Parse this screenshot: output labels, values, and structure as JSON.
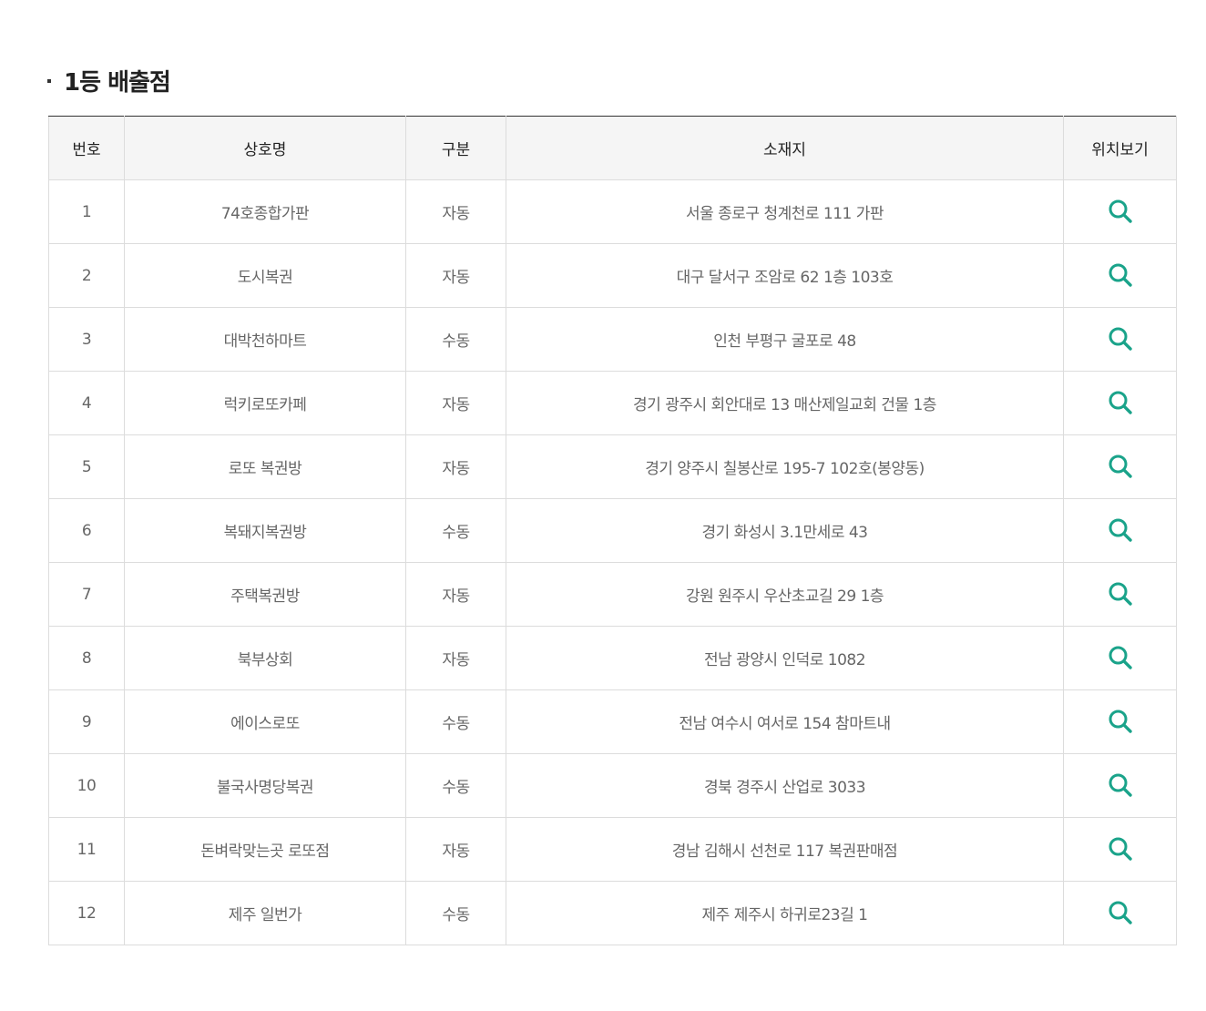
{
  "section": {
    "title": "1등 배출점"
  },
  "table": {
    "columns": [
      "번호",
      "상호명",
      "구분",
      "소재지",
      "위치보기"
    ],
    "rows": [
      {
        "no": "1",
        "name": "74호종합가판",
        "type": "자동",
        "address": "서울 종로구 청계천로 111 가판"
      },
      {
        "no": "2",
        "name": "도시복권",
        "type": "자동",
        "address": "대구 달서구 조암로 62 1층 103호"
      },
      {
        "no": "3",
        "name": "대박천하마트",
        "type": "수동",
        "address": "인천 부평구 굴포로 48"
      },
      {
        "no": "4",
        "name": "럭키로또카페",
        "type": "자동",
        "address": "경기 광주시 회안대로 13 매산제일교회 건물 1층"
      },
      {
        "no": "5",
        "name": "로또 복권방",
        "type": "자동",
        "address": "경기 양주시 칠봉산로 195-7 102호(봉양동)"
      },
      {
        "no": "6",
        "name": "복돼지복권방",
        "type": "수동",
        "address": "경기 화성시 3.1만세로 43"
      },
      {
        "no": "7",
        "name": "주택복권방",
        "type": "자동",
        "address": "강원 원주시 우산초교길 29 1층"
      },
      {
        "no": "8",
        "name": "북부상회",
        "type": "자동",
        "address": "전남 광양시 인덕로 1082"
      },
      {
        "no": "9",
        "name": "에이스로또",
        "type": "수동",
        "address": "전남 여수시 여서로 154 참마트내"
      },
      {
        "no": "10",
        "name": "불국사명당복권",
        "type": "수동",
        "address": "경북 경주시 산업로 3033"
      },
      {
        "no": "11",
        "name": "돈벼락맞는곳 로또점",
        "type": "자동",
        "address": "경남 김해시 선천로 117 복권판매점"
      },
      {
        "no": "12",
        "name": "제주 일번가",
        "type": "수동",
        "address": "제주 제주시 하귀로23길 1"
      }
    ]
  },
  "icons": {
    "location": "search-icon"
  },
  "colors": {
    "accent": "#1aa38a",
    "header_bg": "#f5f5f5",
    "border": "#dcdcdc",
    "top_border": "#333333",
    "cell_text": "#666666"
  }
}
